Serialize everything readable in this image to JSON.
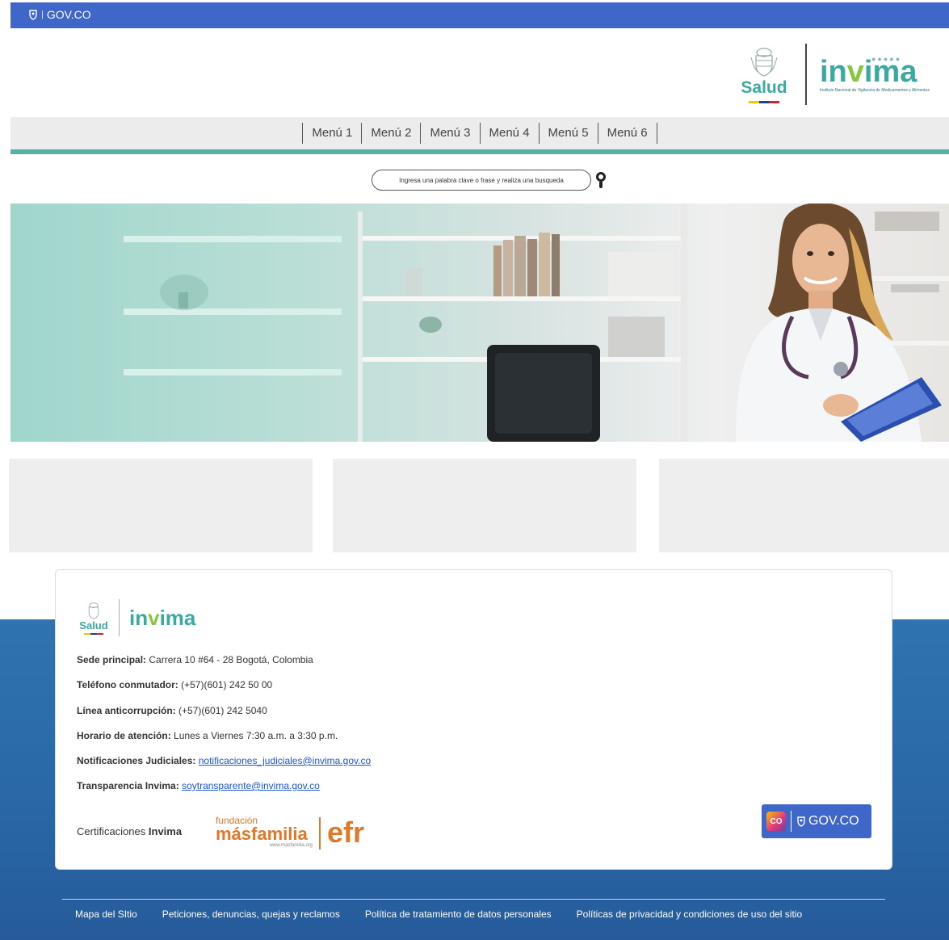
{
  "govbar": {
    "label": "GOV.CO"
  },
  "header": {
    "salud": "Salud",
    "invima": "invima",
    "invima_subtitle": "Instituto Nacional de Vigilancia de Medicamentos y Alimentos",
    "flag_colors": [
      "#f2c500",
      "#1f3f8f",
      "#d1232a"
    ]
  },
  "menu": {
    "items": [
      {
        "label": "Menú 1"
      },
      {
        "label": "Menú 2"
      },
      {
        "label": "Menú 3"
      },
      {
        "label": "Menú 4"
      },
      {
        "label": "Menú 5"
      },
      {
        "label": "Menú 6"
      }
    ]
  },
  "search": {
    "placeholder": "Ingresa una palabra clave o frase y realiza una busqueda",
    "icon": "search-icon"
  },
  "footer": {
    "salud": "Salud",
    "invima": "invima",
    "info": [
      {
        "label": "Sede principal:",
        "value": "Carrera 10 #64 - 28 Bogotá, Colombia"
      },
      {
        "label": "Teléfono conmutador:",
        "value": "(+57)(601) 242 50 00"
      },
      {
        "label": "Línea anticorrupción:",
        "value": "(+57)(601) 242 5040"
      },
      {
        "label": "Horario de atención:",
        "value": "Lunes a Viernes 7:30 a.m. a 3:30 p.m."
      },
      {
        "label": "Notificaciones Judiciales:",
        "link": "notificaciones_judiciales@invima.gov.co"
      },
      {
        "label": "Transparencia Invima:",
        "link": "soytransparente@invima.gov.co"
      }
    ],
    "cert_prefix": "Certificaciones",
    "cert_bold": "Invima",
    "masfamilia": {
      "fundacion": "fundación",
      "name": "másfamilia",
      "url": "www.masfamilia.org"
    },
    "efr": "efr",
    "govco_badge": {
      "co": "CO",
      "label": "GOV.CO"
    },
    "links": [
      "Mapa del SItio",
      "Peticiones, denuncias, quejas y reclamos",
      "Política de tratamiento de datos personales",
      "Políticas de privacidad y condiciones de uso del sitio"
    ]
  },
  "colors": {
    "govbar": "#3f66c9",
    "accent_teal": "#55b2a2",
    "footer_blue": "#2a69a8",
    "efr_orange": "#e0782a"
  }
}
